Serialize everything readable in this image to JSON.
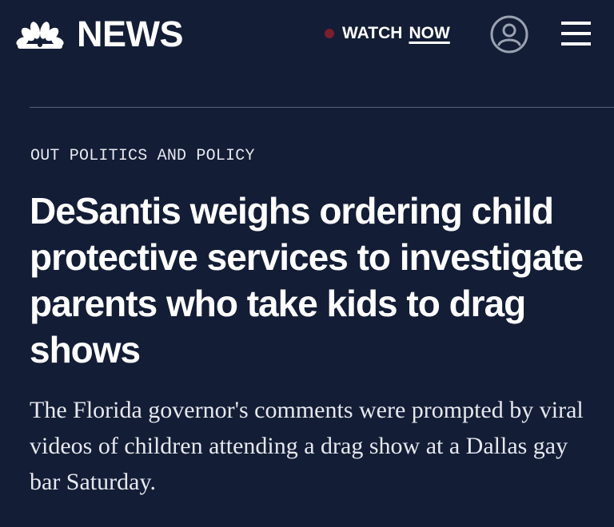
{
  "header": {
    "logo_text": "NEWS",
    "logo_icon": "nbc-peacock-icon",
    "watch_label": "WATCH",
    "watch_now_label": "NOW",
    "live_dot_color": "#7a1f2e",
    "account_icon": "account-icon",
    "menu_icon": "hamburger-menu-icon"
  },
  "article": {
    "kicker": "OUT POLITICS AND POLICY",
    "headline": "DeSantis weighs ordering child protective services to investigate parents who take kids to drag shows",
    "dek": "The Florida governor's comments were prompted by viral videos of children attending a drag show at a Dallas gay bar Saturday."
  },
  "colors": {
    "background": "#131d36",
    "text": "#ffffff"
  }
}
